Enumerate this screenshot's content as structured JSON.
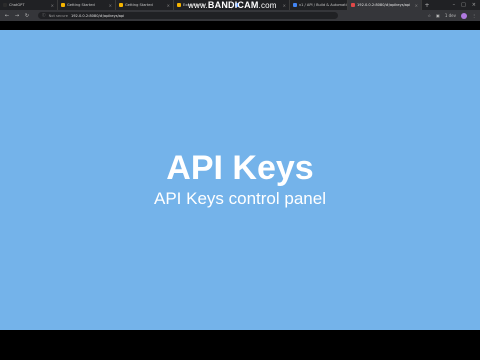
{
  "browser": {
    "tabs": [
      {
        "title": "ChatGPT",
        "color": "#2b2b2b"
      },
      {
        "title": "Getting Started",
        "color": "#f5b400"
      },
      {
        "title": "Getting Started",
        "color": "#f5b400"
      },
      {
        "title": "Excel File To",
        "color": "#f5b400"
      },
      {
        "title": "",
        "color": "#4285f4"
      },
      {
        "title": "v1 / API / Build & Automating Tip...",
        "color": "#4285f4"
      },
      {
        "title": "192.0.0.2:8080/#/apikeys/api",
        "color": "#e04848"
      }
    ],
    "active_tab_index": 6,
    "omnibox": {
      "security_label": "Not secure",
      "url": "192.0.0.2:8080/#/apikeys/api"
    },
    "profile_label": "1 dev"
  },
  "watermark": {
    "prefix": "www.",
    "brand": "BANDICAM",
    "suffix": ".com"
  },
  "page": {
    "background": "#74b3ea",
    "title": "API Keys",
    "subtitle": "API Keys control panel"
  }
}
